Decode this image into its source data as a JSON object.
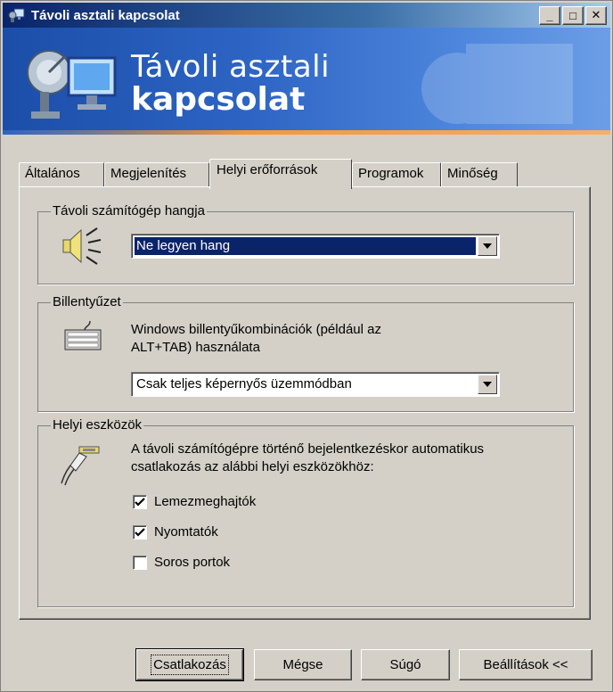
{
  "window": {
    "title": "Távoli asztali kapcsolat",
    "controls": {
      "minimize": "_",
      "maximize": "□",
      "close": "✕"
    }
  },
  "banner": {
    "line1": "Távoli asztali",
    "line2": "kapcsolat",
    "icon": "remote-desktop-logo"
  },
  "tabs": [
    {
      "label": "Általános",
      "active": false
    },
    {
      "label": "Megjelenítés",
      "active": false
    },
    {
      "label": "Helyi erőforrások",
      "active": true
    },
    {
      "label": "Programok",
      "active": false
    },
    {
      "label": "Minőség",
      "active": false
    }
  ],
  "sound": {
    "group_label": "Távoli számítógép hangja",
    "icon": "speaker-icon",
    "selected": "Ne legyen hang"
  },
  "keyboard": {
    "group_label": "Billentyűzet",
    "icon": "keyboard-icon",
    "description_line1": "Windows billentyűkombinációk (például az",
    "description_line2": "ALT+TAB) használata",
    "selected": "Csak teljes képernyős üzemmódban"
  },
  "devices": {
    "group_label": "Helyi eszközök",
    "icon": "device-plug-icon",
    "description_line1": "A távoli számítógépre történő bejelentkezéskor automatikus",
    "description_line2": "csatlakozás az alábbi helyi eszközökhöz:",
    "items": [
      {
        "label": "Lemezmeghajtók",
        "checked": true
      },
      {
        "label": "Nyomtatók",
        "checked": true
      },
      {
        "label": "Soros portok",
        "checked": false
      }
    ]
  },
  "buttons": {
    "connect": "Csatlakozás",
    "cancel": "Mégse",
    "help": "Súgó",
    "options": "Beállítások <<"
  },
  "colors": {
    "face": "#d4d0c8",
    "titlebar": "#0a246a",
    "selection": "#0a246a",
    "banner": "#2d64c4",
    "banner_accent": "#f09a3a"
  }
}
